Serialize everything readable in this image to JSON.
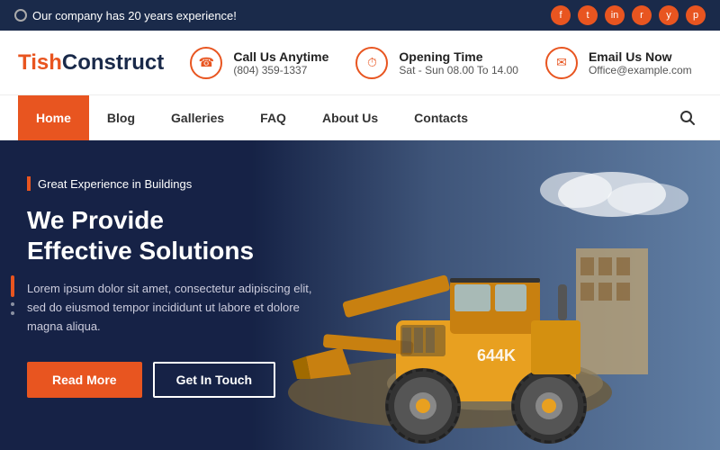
{
  "topbar": {
    "message": "Our company has 20 years experience!",
    "socials": [
      "f",
      "t",
      "in",
      "rss",
      "yt",
      "p"
    ]
  },
  "contact": {
    "logo_part1": "Tish",
    "logo_part2": "Construct",
    "items": [
      {
        "title": "Call Us Anytime",
        "sub": "(804) 359-1337",
        "icon": "☎"
      },
      {
        "title": "Opening Time",
        "sub": "Sat - Sun 08.00 To 14.00",
        "icon": "⏱"
      },
      {
        "title": "Email Us Now",
        "sub": "Office@example.com",
        "icon": "✉"
      }
    ]
  },
  "nav": {
    "items": [
      "Home",
      "Blog",
      "Galleries",
      "FAQ",
      "About Us",
      "Contacts"
    ]
  },
  "hero": {
    "tag": "Great Experience in Buildings",
    "title_line1": "We Provide",
    "title_line2": "Effective Solutions",
    "description": "Lorem ipsum dolor sit amet, consectetur adipiscing elit, sed do eiusmod tempor incididunt ut labore et dolore magna aliqua.",
    "btn_primary": "Read More",
    "btn_secondary": "Get In Touch"
  }
}
